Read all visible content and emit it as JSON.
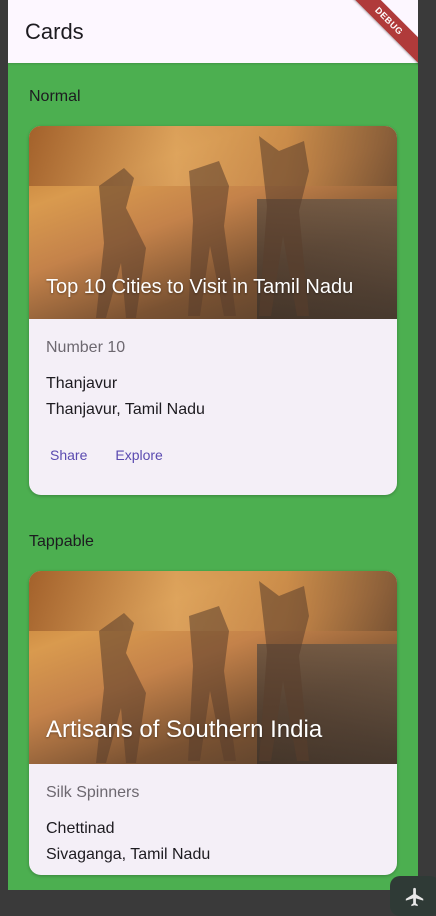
{
  "appbar": {
    "title": "Cards",
    "debug_banner": "DEBUG"
  },
  "sections": [
    {
      "label": "Normal",
      "card": {
        "image_title": "Top 10 Cities to Visit in Tamil Nadu",
        "subtitle": "Number 10",
        "line1": "Thanjavur",
        "line2": "Thanjavur, Tamil Nadu",
        "actions": [
          "Share",
          "Explore"
        ]
      }
    },
    {
      "label": "Tappable",
      "card": {
        "image_title": "Artisans of Southern India",
        "subtitle": "Silk Spinners",
        "line1": "Chettinad",
        "line2": "Sivaganga, Tamil Nadu"
      }
    }
  ],
  "colors": {
    "background": "#4caf50",
    "appbar": "#fdf7ff",
    "card": "#f4eff7",
    "action_text": "#5a4ab0",
    "debug_banner": "#b03a3a"
  },
  "icons": {
    "fab": "plane-icon"
  }
}
